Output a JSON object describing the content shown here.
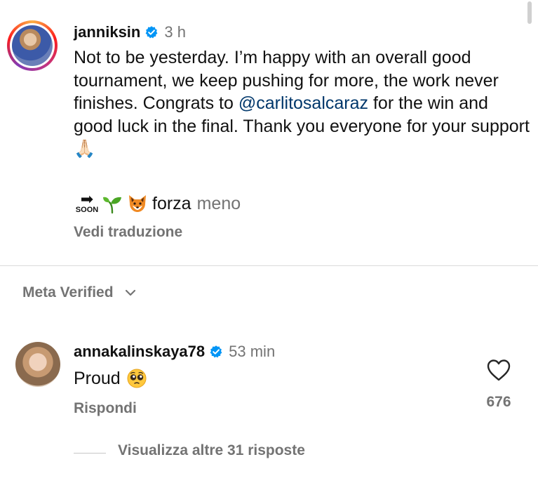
{
  "post": {
    "username": "janniksin",
    "time": "3 h",
    "caption_before": "Not to be yesterday. I’m happy with an overall good tournament, we keep pushing for more, the work never finishes. Congrats to",
    "mention": "@carlitosalcaraz",
    "caption_after": "for the win and good luck in the final. Thank you everyone for your support",
    "caption_emoji": "🙏🏻",
    "soon_label": "SOON",
    "soon_arrow": "➡",
    "sign_forza": "forza",
    "sign_meno": "meno",
    "translate_label": "Vedi traduzione"
  },
  "meta": {
    "label": "Meta Verified"
  },
  "comment": {
    "username": "annakalinskaya78",
    "time": "53 min",
    "text": "Proud",
    "reply_label": "Rispondi",
    "likes": "676"
  },
  "more_replies": {
    "label": "Visualizza altre 31 risposte"
  },
  "icons": {
    "verified": "verified-badge-icon",
    "heart": "heart-outline-icon",
    "chevron": "chevron-down-icon",
    "sprout": "seedling-emoji-icon",
    "fox": "fox-emoji-icon",
    "pleading": "pleading-face-emoji-icon"
  },
  "colors": {
    "verified_blue": "#0095f6",
    "mention": "#00376b",
    "secondary_text": "#737373"
  }
}
